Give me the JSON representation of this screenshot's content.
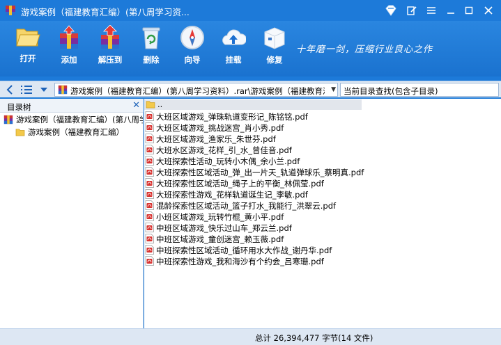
{
  "window": {
    "title": "游戏案例（福建教育汇编）(第八周学习资..."
  },
  "toolbar": {
    "buttons": [
      {
        "label": "打开",
        "icon": "folder-open-icon"
      },
      {
        "label": "添加",
        "icon": "archive-add-icon"
      },
      {
        "label": "解压到",
        "icon": "extract-icon"
      },
      {
        "label": "删除",
        "icon": "recycle-bin-icon"
      },
      {
        "label": "向导",
        "icon": "compass-icon"
      },
      {
        "label": "挂载",
        "icon": "cloud-upload-icon"
      },
      {
        "label": "修复",
        "icon": "repair-box-icon"
      }
    ],
    "slogan": "十年磨一剑，压缩行业良心之作"
  },
  "address": {
    "path": "游戏案例（福建教育汇编）(第八周学习资料）.rar\\游戏案例（福建教育汇编）",
    "search_label": "当前目录查找(包含子目录)"
  },
  "tree": {
    "title": "目录树",
    "root": "游戏案例（福建教育汇编）(第八周学习资料）.rar",
    "child": "游戏案例（福建教育汇编）"
  },
  "files": {
    "parent": "..",
    "items": [
      "大班区域游戏_弹珠轨道变形记_陈铭铭.pdf",
      "大班区域游戏_挑战迷宫_肖小秀.pdf",
      "大班区域游戏_渔家乐_朱世芬.pdf",
      "大班水区游戏_花样_引_水_曾佳音.pdf",
      "大班探索性活动_玩转小木偶_余小兰.pdf",
      "大班探索性区域活动_弹_出一片天_轨道弹球乐_蔡明真.pdf",
      "大班探索性区域活动_绳子上的平衡_林佩莹.pdf",
      "大班探索性游戏_花样轨道诞生记_李敏.pdf",
      "混龄探索性区域活动_篮子打水_我能行_洪翠云.pdf",
      "小班区域游戏_玩转竹棍_黄小平.pdf",
      "中班区域游戏_快乐过山车_郑云兰.pdf",
      "中班区域游戏_童创迷宫_赖玉薇.pdf",
      "中班探索性区域活动_循环用水大作战_谢丹华.pdf",
      "中班探索性游戏_我和海沙有个约会_吕寒珊.pdf"
    ]
  },
  "status": {
    "text": "总计  26,394,477 字节(14 文件)"
  },
  "colors": {
    "titlebar": "#1d7ad9",
    "toolbar": "#1a72cf",
    "folder": "#f3c94a",
    "pdf": "#d8322f"
  }
}
